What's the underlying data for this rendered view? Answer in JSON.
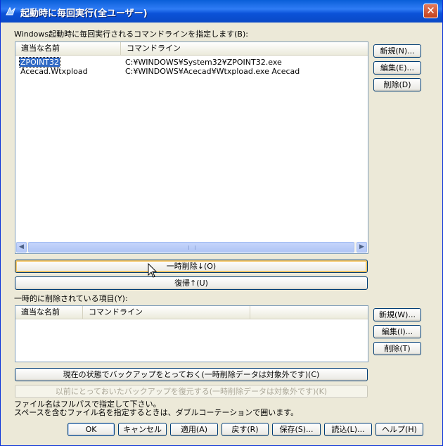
{
  "window": {
    "title": "起動時に毎回実行(全ユーザー)",
    "close_label": "✕"
  },
  "top_section": {
    "label": "Windows起動時に毎回実行されるコマンドラインを指定します(B):",
    "columns": [
      "適当な名前",
      "コマンドライン"
    ],
    "rows": [
      {
        "name": "ZPOINT32",
        "command": "C:¥WINDOWS¥System32¥ZPOINT32.exe",
        "selected": true
      },
      {
        "name": "Acecad.Wtxpload",
        "command": "C:¥WINDOWS¥Acecad¥Wtxpload.exe Acecad",
        "selected": false
      }
    ],
    "buttons": {
      "new": "新規(N)...",
      "edit": "編集(E)...",
      "delete": "削除(D)"
    }
  },
  "middle_buttons": {
    "temp_delete": "一時削除↓(O)",
    "restore": "復帰↑(U)"
  },
  "bottom_section": {
    "label": "一時的に削除されている項目(Y):",
    "columns": [
      "適当な名前",
      "コマンドライン"
    ],
    "rows": [],
    "buttons": {
      "new": "新規(W)...",
      "edit": "編集(I)...",
      "delete": "削除(T)"
    }
  },
  "backup": {
    "save": "現在の状態でバックアップをとっておく(一時削除データは対象外です)(C)",
    "restore": "以前にとっておいたバックアップを復元する(一時削除データは対象外です)(K)"
  },
  "notes": [
    "ファイル名はフルパスで指定して下さい。",
    "スペースを含むファイル名を指定するときは、ダブルコーテーションで囲います。"
  ],
  "footer": {
    "ok": "OK",
    "cancel": "キャンセル",
    "apply": "適用(A)",
    "back": "戻す(R)",
    "save": "保存(S)...",
    "load": "読込(L)...",
    "help": "ヘルプ(H)"
  }
}
